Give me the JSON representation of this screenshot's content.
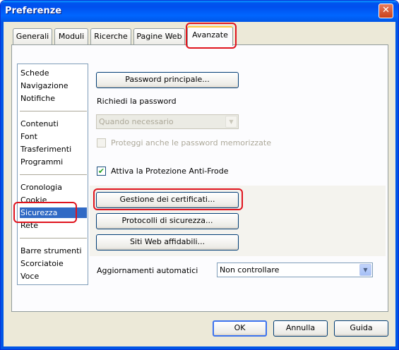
{
  "window": {
    "title": "Preferenze",
    "close_label": "✕"
  },
  "tabs": [
    {
      "label": "Generali"
    },
    {
      "label": "Moduli"
    },
    {
      "label": "Ricerche"
    },
    {
      "label": "Pagine Web"
    },
    {
      "label": "Avanzate",
      "active": true
    }
  ],
  "sidebar": {
    "groups": [
      [
        "Schede",
        "Navigazione",
        "Notifiche"
      ],
      [
        "Contenuti",
        "Font",
        "Trasferimenti",
        "Programmi"
      ],
      [
        "Cronologia",
        "Cookie",
        "Sicurezza",
        "Rete"
      ],
      [
        "Barre strumenti",
        "Scorciatoie",
        "Voce"
      ]
    ],
    "selected": "Sicurezza"
  },
  "security": {
    "master_password_button": "Password principale...",
    "ask_password_label": "Richiedi la password",
    "ask_password_value": "Quando necessario",
    "protect_saved_label": "Proteggi anche le password memorizzate",
    "protect_saved_checked": false,
    "fraud_protection_label": "Attiva la Protezione Anti-Frode",
    "fraud_protection_checked": true,
    "certificates_button": "Gestione dei certificati...",
    "protocols_button": "Protocolli di sicurezza...",
    "trusted_sites_button": "Siti Web affidabili...",
    "auto_updates_label": "Aggiornamenti automatici",
    "auto_updates_value": "Non controllare"
  },
  "footer": {
    "ok_label": "OK",
    "cancel_label": "Annulla",
    "help_label": "Guida"
  },
  "colors": {
    "titlebar": "#0055e6",
    "highlight_ring": "#e0141e",
    "selection": "#316ac5"
  }
}
